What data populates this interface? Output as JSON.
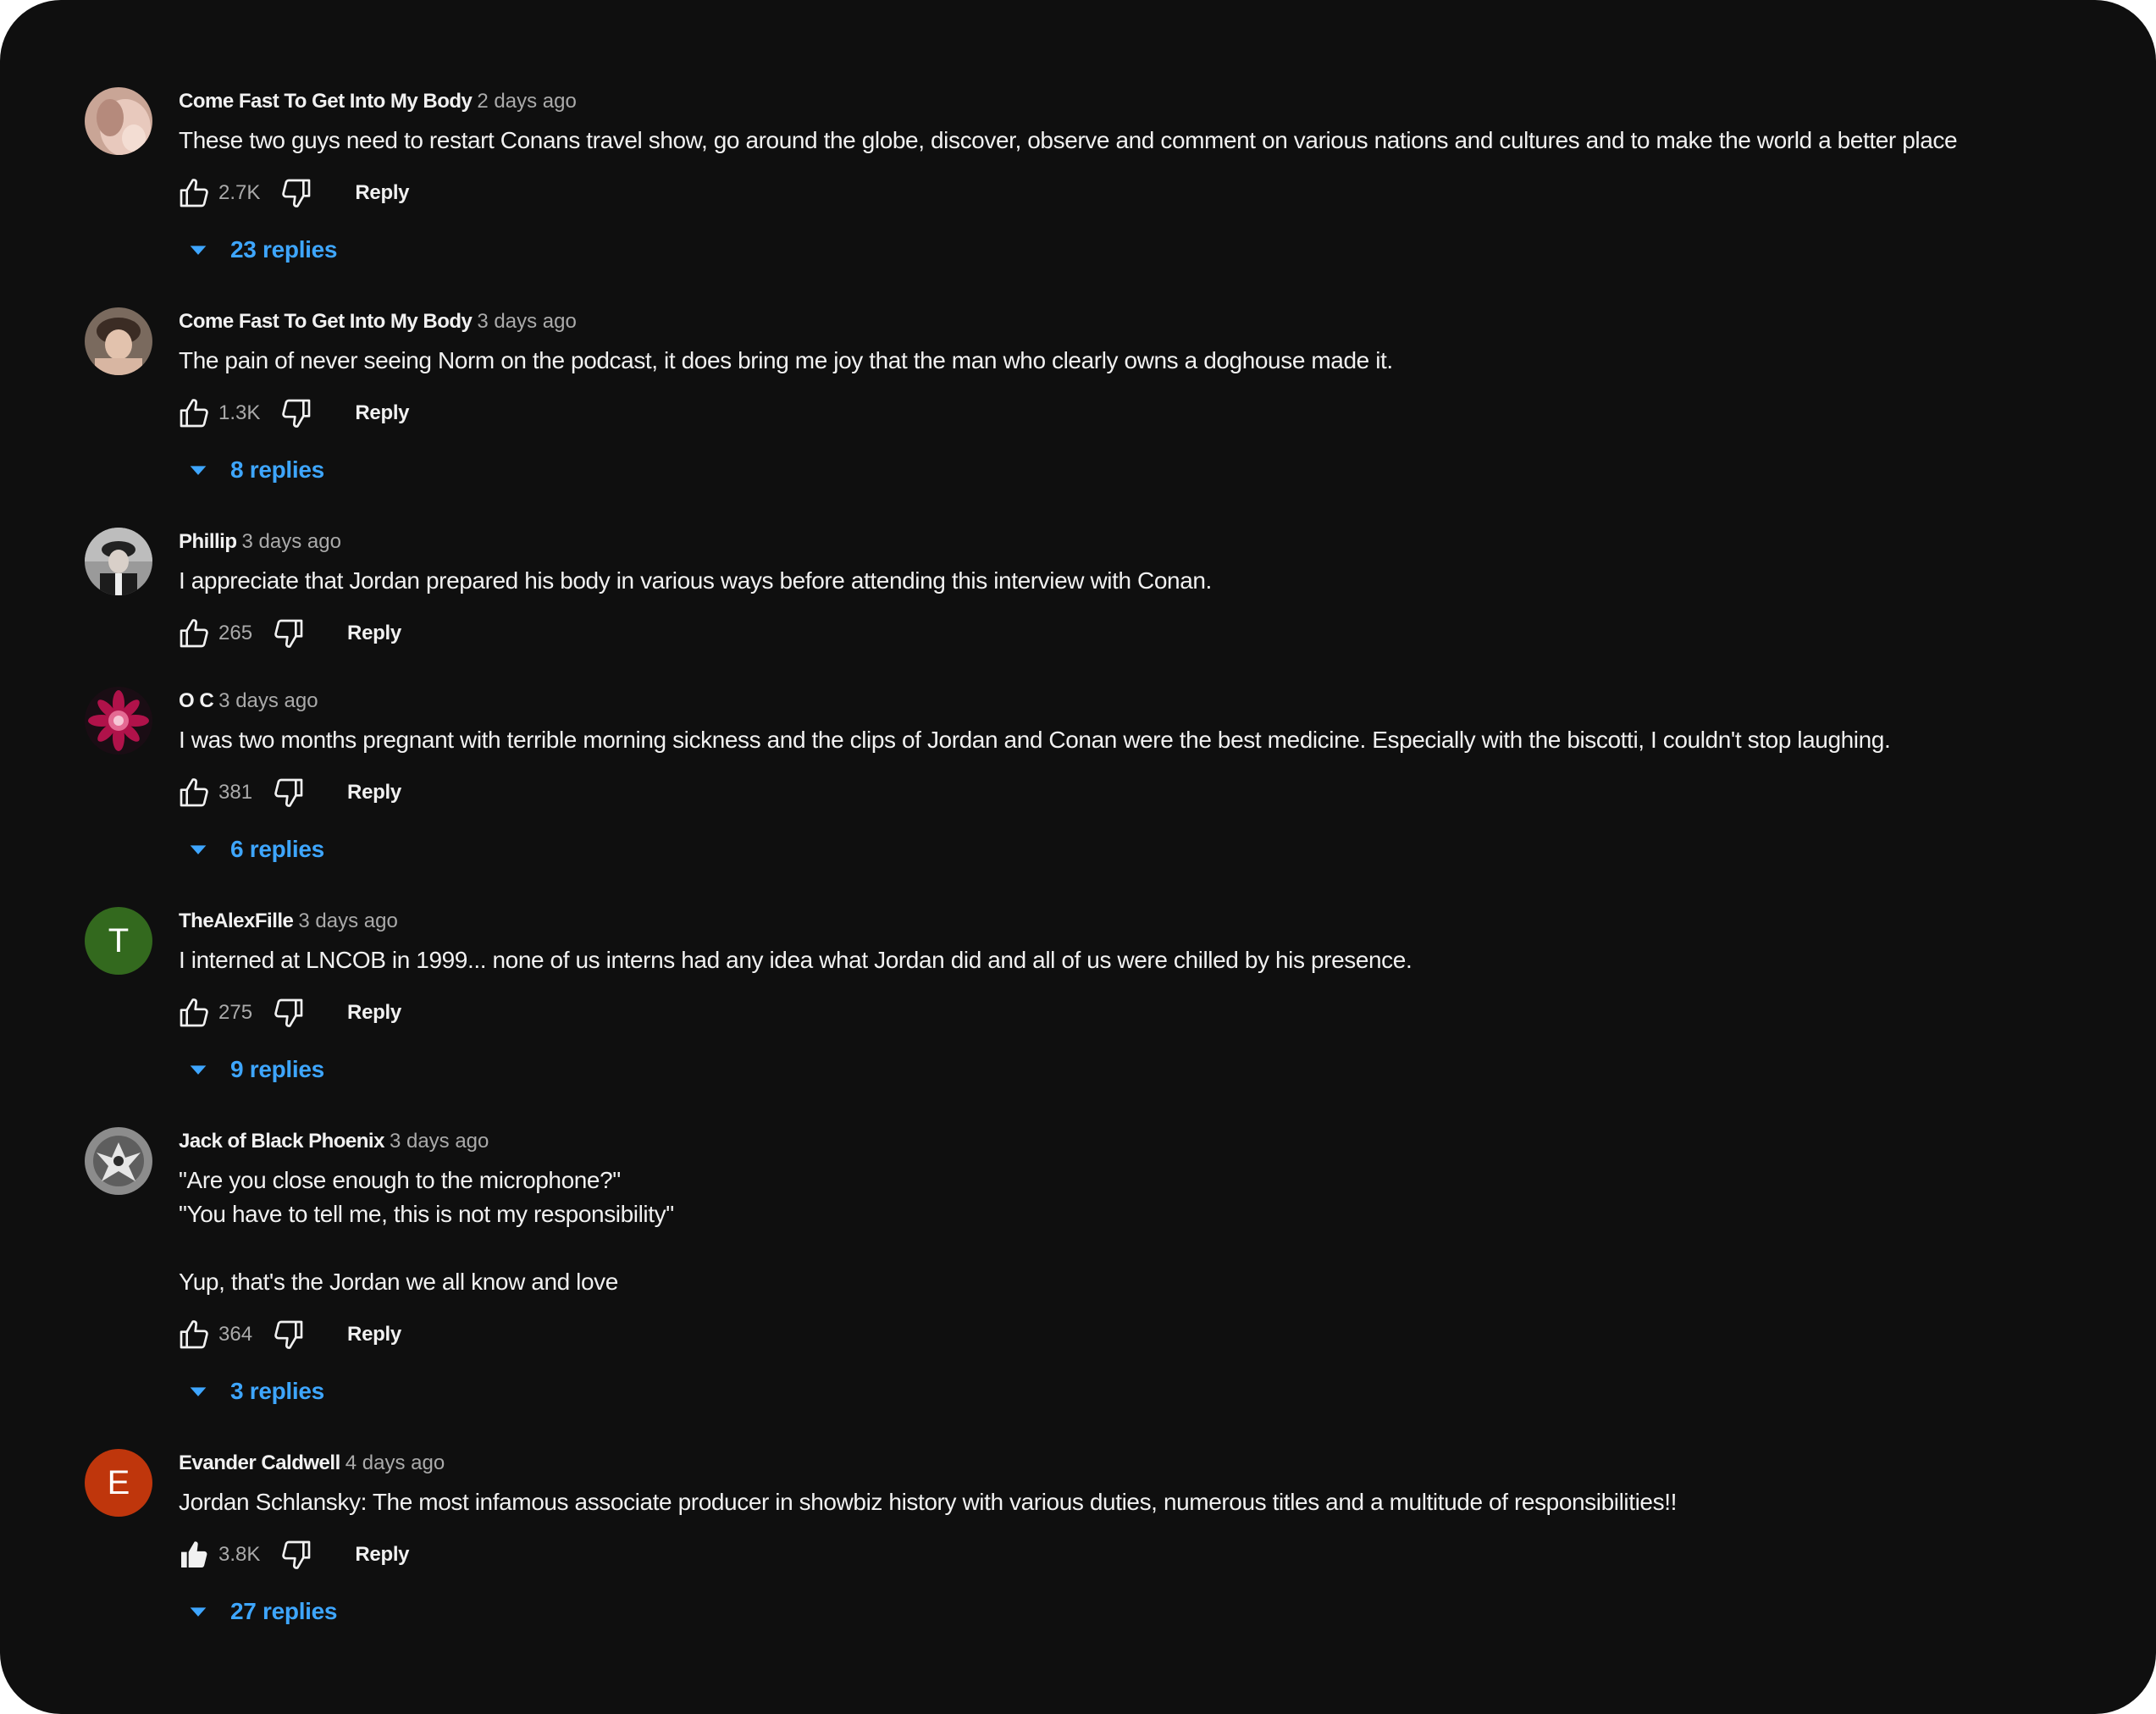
{
  "colors": {
    "background": "#0f0f0f",
    "text_primary": "#f1f1f1",
    "text_secondary": "#aaaaaa",
    "link_blue": "#3ea6ff"
  },
  "icons": {
    "like": "thumbs-up-outline-icon",
    "like_active": "thumbs-up-filled-icon",
    "dislike": "thumbs-down-outline-icon",
    "expand": "caret-down-icon"
  },
  "comments": [
    {
      "author": "Come Fast To Get Into My Body",
      "time": "2 days ago",
      "text": "These two guys need to restart Conans travel show, go around the globe, discover, observe and comment on various nations and cultures and to make the world a better place",
      "likes": "2.7K",
      "liked": false,
      "reply_label": "Reply",
      "replies": "23 replies"
    },
    {
      "author": "Come Fast To Get Into My Body",
      "time": "3 days ago",
      "text": "The pain of never seeing Norm on the podcast, it does bring me joy that the man who clearly owns a doghouse made it.",
      "likes": "1.3K",
      "liked": false,
      "reply_label": "Reply",
      "replies": "8 replies"
    },
    {
      "author": "Phillip",
      "time": "3 days ago",
      "text": "I appreciate that Jordan prepared his body in various ways before attending this interview with Conan.",
      "likes": "265",
      "liked": false,
      "reply_label": "Reply"
    },
    {
      "author": "O C",
      "time": "3 days ago",
      "text": "I was two months pregnant with terrible morning sickness and the clips of Jordan and Conan were the best medicine. Especially with the biscotti, I couldn't stop laughing.",
      "likes": "381",
      "liked": false,
      "reply_label": "Reply",
      "replies": "6 replies"
    },
    {
      "author": "TheAlexFille",
      "time": "3 days ago",
      "avatar_letter": "T",
      "avatar_color": "#33691e",
      "text": "I interned at LNCOB in 1999... none of us interns had any idea what Jordan did and all of us were chilled by his presence.",
      "likes": "275",
      "liked": false,
      "reply_label": "Reply",
      "replies": "9 replies"
    },
    {
      "author": "Jack of Black Phoenix",
      "time": "3 days ago",
      "text": "\"Are you close enough to the microphone?\"\n\"You have to tell me, this is not my responsibility\"\n\nYup, that's the Jordan we all know and love",
      "likes": "364",
      "liked": false,
      "reply_label": "Reply",
      "replies": "3 replies"
    },
    {
      "author": "Evander Caldwell",
      "time": "4 days ago",
      "avatar_letter": "E",
      "avatar_color": "#bf360c",
      "text": "Jordan Schlansky: The most infamous associate producer in showbiz history with various duties, numerous titles and a multitude of responsibilities!!",
      "likes": "3.8K",
      "liked": true,
      "reply_label": "Reply",
      "replies": "27 replies"
    }
  ]
}
